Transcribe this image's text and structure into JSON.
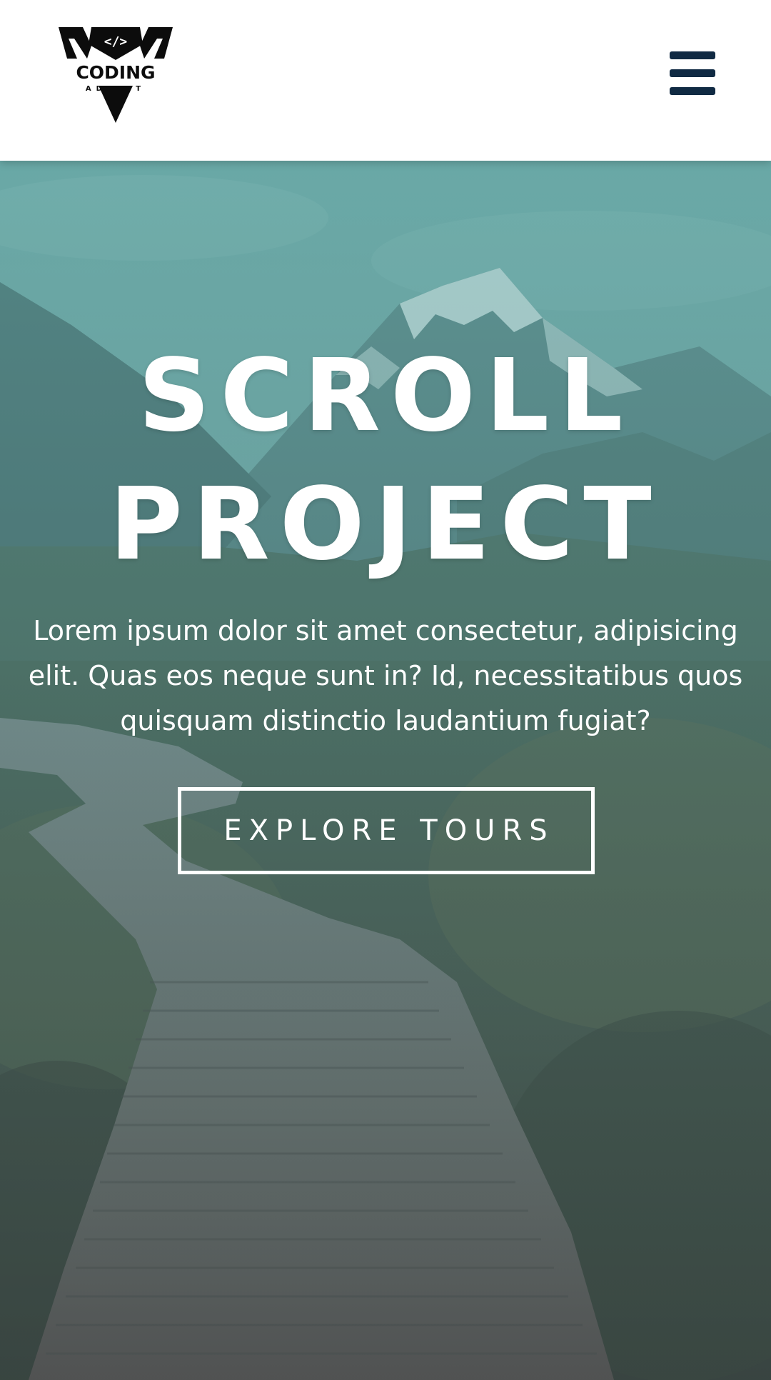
{
  "navbar": {
    "logo": {
      "icon": "coding-addict-logo",
      "line1": "CODING",
      "line2": "ADDICT",
      "glyph": "</>"
    },
    "menu_icon": "hamburger-menu-icon"
  },
  "hero": {
    "title_line1": "SCROLL",
    "title_line2": "PROJECT",
    "text": "Lorem ipsum dolor sit amet consectetur, adipisicing elit. Quas eos neque sunt in? Id, necessitatibus quos quisquam distinctio laudantium fugiat?",
    "button_label": "EXPLORE TOURS"
  },
  "colors": {
    "navbar_bg": "#ffffff",
    "menu_icon": "#102a43",
    "hero_text": "#ffffff",
    "overlay": "#5fa8a4"
  }
}
